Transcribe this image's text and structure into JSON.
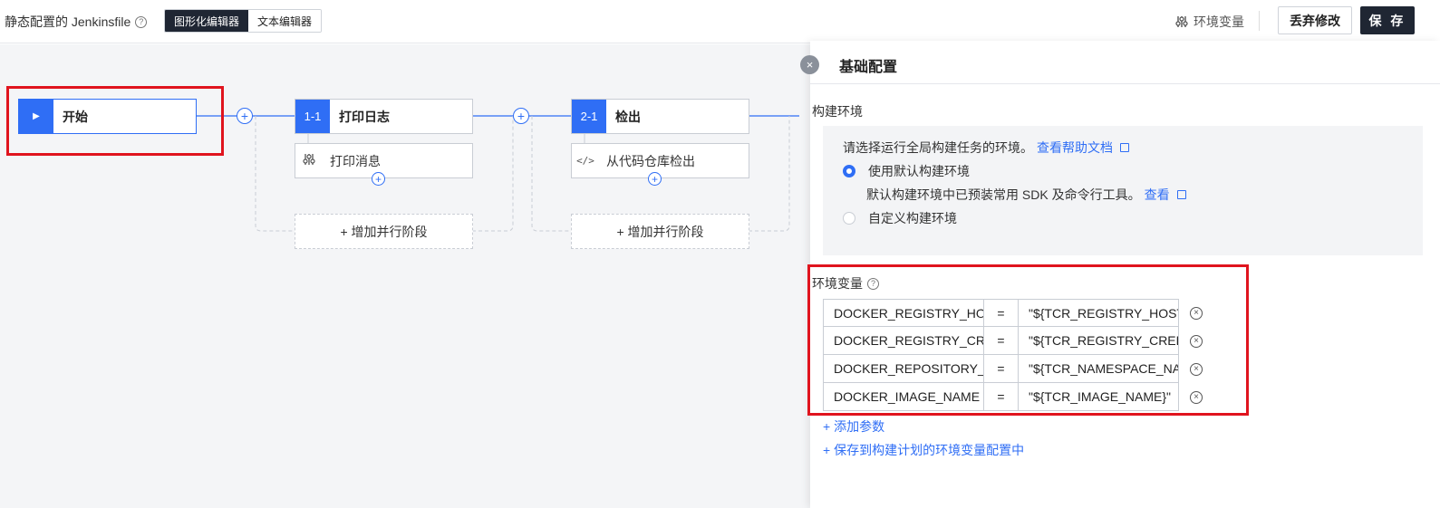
{
  "topbar": {
    "file_title": "静态配置的 Jenkinsfile",
    "help_icon": "question-circle",
    "editor_tabs": [
      "图形化编辑器",
      "文本编辑器"
    ],
    "active_tab": "图形化编辑器",
    "env_var_label": "环境变量",
    "discard_label": "丢弃修改",
    "save_label": "保 存"
  },
  "pipeline": {
    "start_label": "开始",
    "stages": [
      {
        "badge": "1-1",
        "title": "打印日志",
        "step_label": "打印消息",
        "step_icon": "sliders-icon"
      },
      {
        "badge": "2-1",
        "title": "检出",
        "step_label": "从代码仓库检出",
        "step_icon": "code-icon"
      }
    ],
    "add_parallel_label": "+ 增加并行阶段",
    "plus_glyph": "+"
  },
  "panel": {
    "title": "基础配置",
    "close_glyph": "×",
    "build_env": {
      "label": "构建环境",
      "hint": "请选择运行全局构建任务的环境。",
      "help_link": "查看帮助文档",
      "option_default": "使用默认构建环境",
      "default_desc": "默认构建环境中已预装常用 SDK 及命令行工具。",
      "view_link": "查看",
      "option_custom": "自定义构建环境",
      "selected": "使用默认构建环境"
    },
    "env_vars": {
      "label": "环境变量",
      "eq": "=",
      "del_glyph": "×",
      "rows": [
        {
          "key": "DOCKER_REGISTRY_HOST",
          "value": "\"${TCR_REGISTRY_HOST}\""
        },
        {
          "key": "DOCKER_REGISTRY_CREDENTIALS",
          "value": "\"${TCR_REGISTRY_CREDENTIALS}\""
        },
        {
          "key": "DOCKER_REPOSITORY_NAME",
          "value": "\"${TCR_NAMESPACE_NAME}\""
        },
        {
          "key": "DOCKER_IMAGE_NAME",
          "value": "\"${TCR_IMAGE_NAME}\""
        }
      ],
      "add_param": "+ 添加参数",
      "save_to_plan": "+ 保存到构建计划的环境变量配置中"
    }
  },
  "colors": {
    "accent": "#2f6ef5",
    "dark": "#1f2633",
    "highlight": "#e0141e"
  }
}
